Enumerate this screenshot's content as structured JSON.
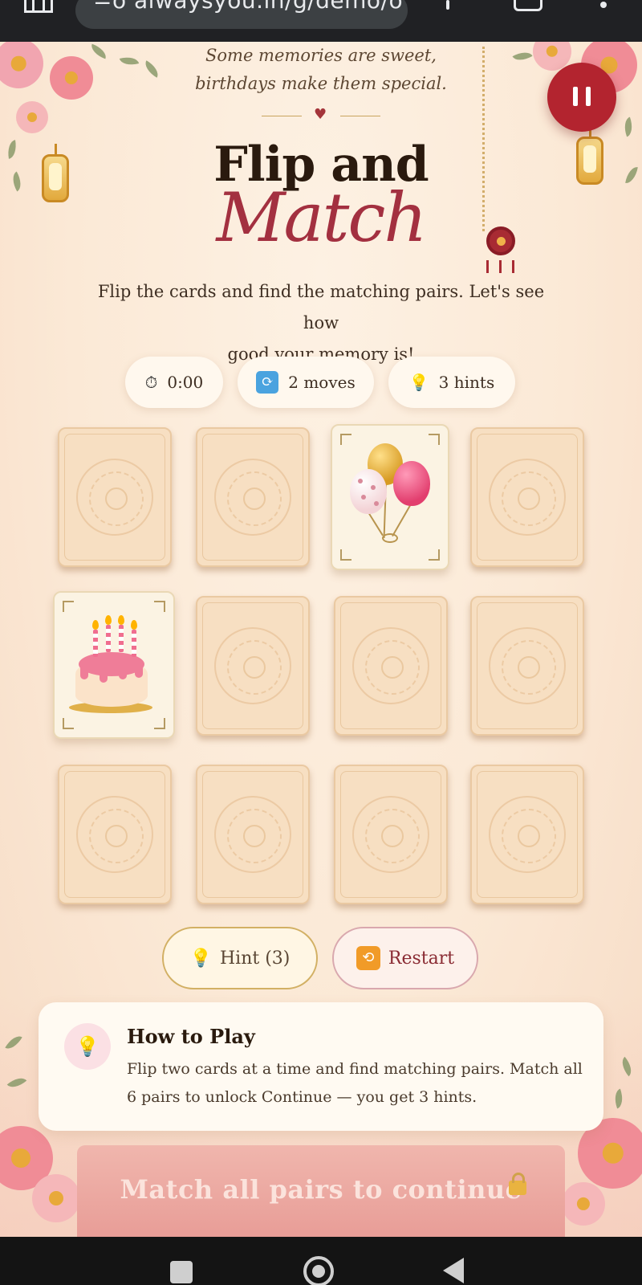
{
  "browser": {
    "url": "=o alwaysyou.in/g/demo/ov"
  },
  "header": {
    "tagline_line1": "Some memories are sweet,",
    "tagline_line2": "birthdays make them special.",
    "title_line1": "Flip and",
    "title_line2": "Match"
  },
  "instructions": {
    "line1": "Flip the cards and find the matching pairs. Let's see how",
    "line2": "good your memory is!"
  },
  "stats": {
    "timer": "0:00",
    "moves": "2 moves",
    "hints": "3 hints"
  },
  "board": {
    "rows": 3,
    "columns": 4,
    "revealed": [
      {
        "row": 1,
        "column": 3,
        "icon": "balloons-icon"
      },
      {
        "row": 2,
        "column": 1,
        "icon": "birthday-cake-icon"
      }
    ]
  },
  "buttons": {
    "hint_label": "Hint (3)",
    "restart_label": "Restart"
  },
  "how_to_play": {
    "title": "How to Play",
    "text": "Flip two cards at a time and find matching pairs. Match all 6 pairs to unlock Continue — you get 3 hints."
  },
  "continue": {
    "label": "Match all pairs to continue"
  },
  "colors": {
    "accent": "#b3242f",
    "title": "#2a1a0e",
    "script_title": "#a33040",
    "card_back": "#f7dfc2",
    "continue_bar": "#e89d97"
  }
}
